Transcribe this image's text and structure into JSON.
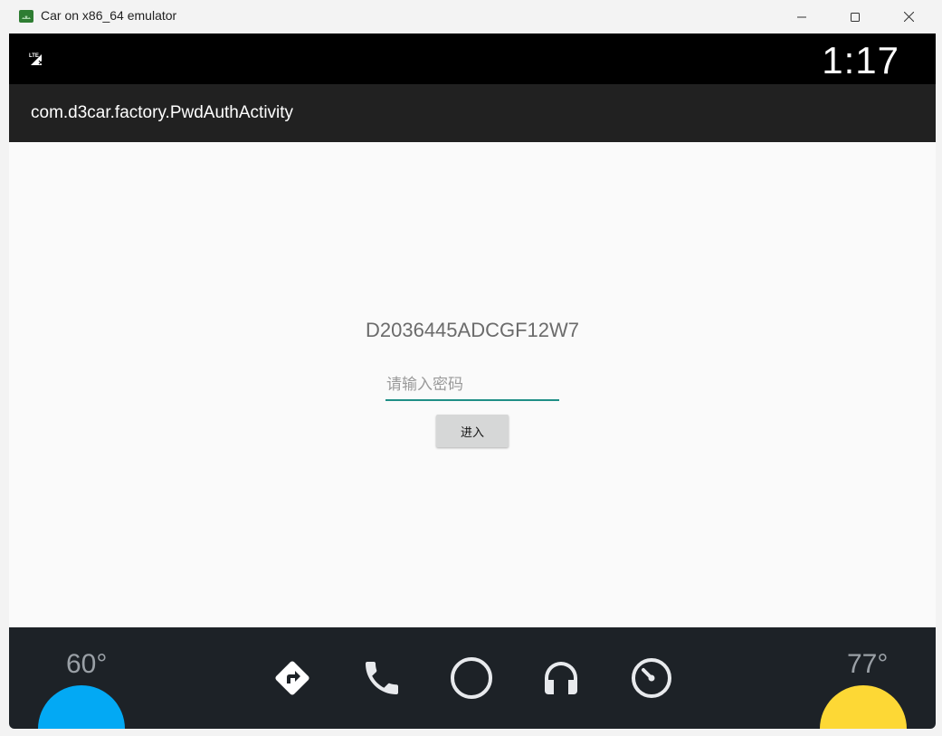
{
  "window": {
    "title": "Car on x86_64 emulator"
  },
  "statusbar": {
    "signal_icon": "lte-no-signal-icon",
    "signal_label": "LTE",
    "time": "1:17"
  },
  "actionbar": {
    "title": "com.d3car.factory.PwdAuthActivity"
  },
  "content": {
    "device_id": "D2036445ADCGF12W7",
    "password_placeholder": "请输入密码",
    "password_value": "",
    "enter_button": "进入"
  },
  "navbar": {
    "temp_left": "60°",
    "temp_right": "77°",
    "buttons": [
      "maps-navigation-icon",
      "phone-icon",
      "home-circle-icon",
      "headphones-icon",
      "dashboard-gauge-icon"
    ]
  },
  "colors": {
    "accent": "#1f8f86",
    "hvac_left": "#03a9f4",
    "hvac_right": "#fdd835",
    "navbar_bg": "#1d2227",
    "actionbar_bg": "#212121"
  }
}
